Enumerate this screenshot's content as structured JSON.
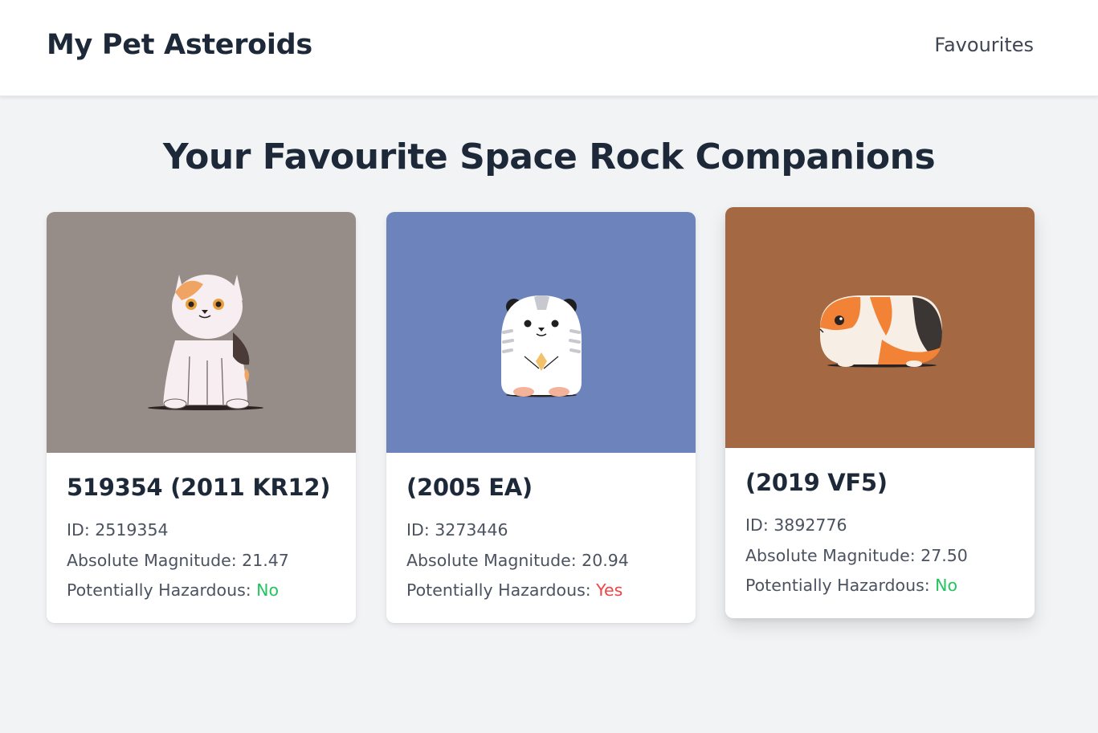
{
  "header": {
    "brand": "My Pet Asteroids",
    "nav_favourites": "Favourites"
  },
  "main": {
    "title": "Your Favourite Space Rock Companions"
  },
  "labels": {
    "id": "ID: ",
    "magnitude": "Absolute Magnitude: ",
    "hazardous": "Potentially Hazardous: "
  },
  "cards": [
    {
      "name": "519354 (2011 KR12)",
      "id": "2519354",
      "magnitude": "21.47",
      "hazardous": "No",
      "pet": "cat",
      "image_bg": "#968c88"
    },
    {
      "name": "(2005 EA)",
      "id": "3273446",
      "magnitude": "20.94",
      "hazardous": "Yes",
      "pet": "hamster",
      "image_bg": "#6c83bc"
    },
    {
      "name": "(2019 VF5)",
      "id": "3892776",
      "magnitude": "27.50",
      "hazardous": "No",
      "pet": "guinea-pig",
      "image_bg": "#a46843"
    }
  ],
  "colors": {
    "hazard_no": "#22c55e",
    "hazard_yes": "#ef4444",
    "text_primary": "#1d2939",
    "page_bg": "#f2f3f5"
  }
}
